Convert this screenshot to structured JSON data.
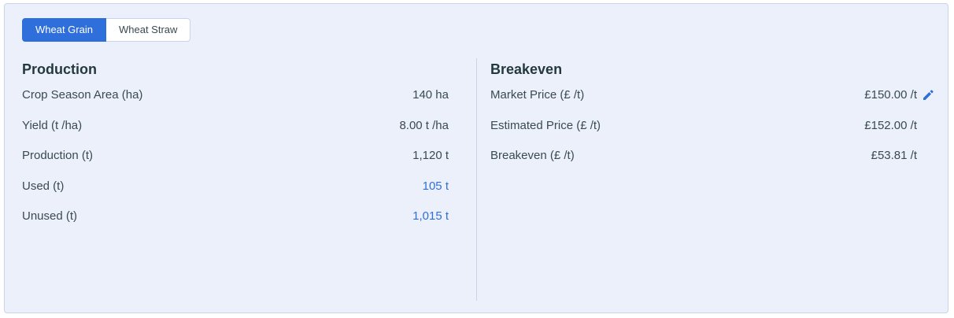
{
  "tabs": {
    "grain": "Wheat Grain",
    "straw": "Wheat Straw"
  },
  "production": {
    "title": "Production",
    "rows": [
      {
        "label": "Crop Season Area (ha)",
        "value": "140 ha"
      },
      {
        "label": "Yield (t /ha)",
        "value": "8.00 t /ha"
      },
      {
        "label": "Production (t)",
        "value": "1,120 t"
      },
      {
        "label": "Used (t)",
        "value": "105 t"
      },
      {
        "label": "Unused (t)",
        "value": "1,015 t"
      }
    ]
  },
  "breakeven": {
    "title": "Breakeven",
    "rows": [
      {
        "label": "Market Price (£ /t)",
        "value": "£150.00 /t"
      },
      {
        "label": "Estimated Price (£ /t)",
        "value": "£152.00 /t"
      },
      {
        "label": "Breakeven (£ /t)",
        "value": "£53.81 /t"
      }
    ]
  },
  "colors": {
    "accent": "#2f6fdc",
    "card_bg": "#ecf0fb",
    "text": "#3a4a4f",
    "heading": "#24393d"
  },
  "icons": {
    "edit": "pencil-icon"
  }
}
